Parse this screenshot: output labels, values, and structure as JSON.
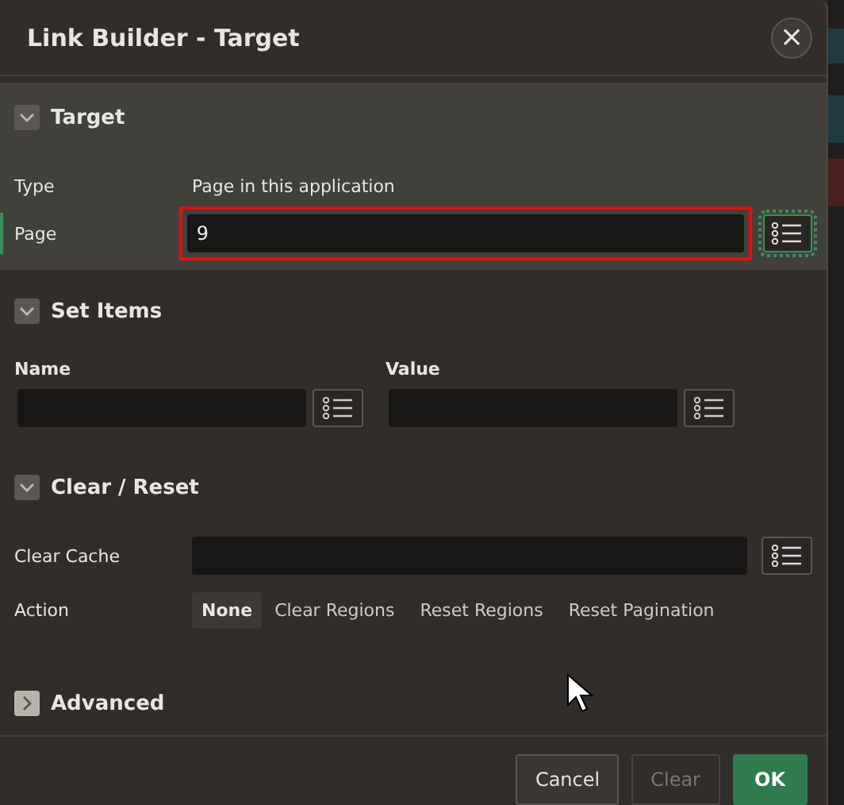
{
  "dialog": {
    "title": "Link Builder - Target",
    "close_label": "×"
  },
  "target": {
    "title": "Target",
    "expanded": true,
    "active": true,
    "type": {
      "label": "Type",
      "value": "Page in this application"
    },
    "page": {
      "label": "Page",
      "value": "9",
      "required": true,
      "outlined": true
    }
  },
  "set_items": {
    "title": "Set Items",
    "expanded": true,
    "columns": [
      {
        "label": "Name"
      },
      {
        "label": "Value"
      }
    ]
  },
  "clear_reset": {
    "title": "Clear / Reset",
    "expanded": true,
    "clear_cache": {
      "label": "Clear Cache"
    },
    "action": {
      "label": "Action",
      "options": [
        {
          "label": "None",
          "selected": true
        },
        {
          "label": "Clear Regions",
          "selected": false
        },
        {
          "label": "Reset Regions",
          "selected": false
        },
        {
          "label": "Reset Pagination",
          "selected": false
        }
      ]
    }
  },
  "advanced": {
    "title": "Advanced",
    "expanded": false
  },
  "buttons": [
    {
      "label": "Cancel",
      "kind": "normal",
      "disabled": false
    },
    {
      "label": "Clear",
      "kind": "normal",
      "disabled": true
    },
    {
      "label": "OK",
      "kind": "primary",
      "disabled": false
    }
  ]
}
